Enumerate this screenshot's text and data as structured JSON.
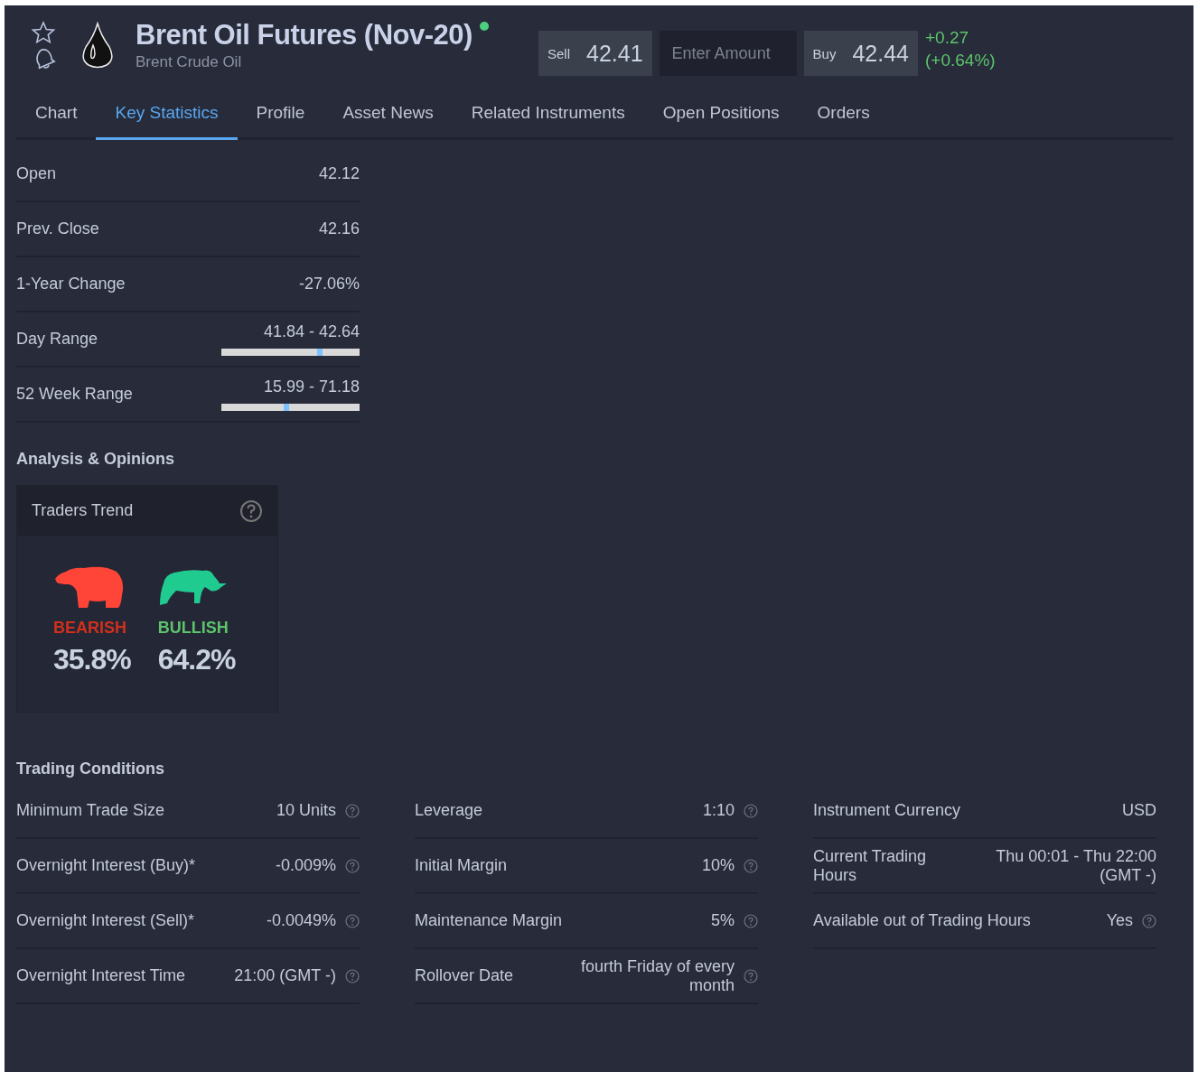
{
  "header": {
    "title": "Brent Oil Futures (Nov-20)",
    "online": true,
    "subtitle": "Brent Crude Oil",
    "sell": {
      "label": "Sell",
      "price": "42.41"
    },
    "amount": {
      "placeholder": "Enter Amount"
    },
    "buy": {
      "label": "Buy",
      "price": "42.44"
    },
    "change": "+0.27",
    "change_pct": "(+0.64%)"
  },
  "tabs": [
    {
      "label": "Chart",
      "selected": false
    },
    {
      "label": "Key Statistics",
      "selected": true
    },
    {
      "label": "Profile",
      "selected": false
    },
    {
      "label": "Asset News",
      "selected": false
    },
    {
      "label": "Related Instruments",
      "selected": false
    },
    {
      "label": "Open Positions",
      "selected": false
    },
    {
      "label": "Orders",
      "selected": false
    }
  ],
  "stats": [
    {
      "label": "Open",
      "value": "42.12"
    },
    {
      "label": "Prev. Close",
      "value": "42.16"
    },
    {
      "label": "1-Year Change",
      "value": "-27.06%"
    },
    {
      "label": "Day Range",
      "value": "41.84 - 42.64",
      "level": 0.71
    },
    {
      "label": "52 Week Range",
      "value": "15.99 - 71.18",
      "level": 0.47
    }
  ],
  "analysis": {
    "heading": "Analysis & Opinions",
    "card_title": "Traders Trend",
    "trends": [
      {
        "kind": "bear",
        "label": "BEARISH",
        "color": "#d0301c",
        "percent": "35.8%"
      },
      {
        "kind": "bull",
        "label": "BULLISH",
        "color": "#5cc46a",
        "percent": "64.2%"
      }
    ]
  },
  "trading": {
    "heading": "Trading Conditions",
    "columns": [
      [
        {
          "label": "Minimum Trade Size",
          "value": "10 Units",
          "help": true
        },
        {
          "label": "Overnight Interest (Buy)*",
          "value": "-0.009%",
          "help": true
        },
        {
          "label": "Overnight Interest (Sell)*",
          "value": "-0.0049%",
          "help": true
        },
        {
          "label": "Overnight Interest Time",
          "value": "21:00 (GMT -)",
          "help": true
        }
      ],
      [
        {
          "label": "Leverage",
          "value": "1:10",
          "help": true
        },
        {
          "label": "Initial Margin",
          "value": "10%",
          "help": true
        },
        {
          "label": "Maintenance Margin",
          "value": "5%",
          "help": true
        },
        {
          "label": "Rollover Date",
          "value": "fourth Friday of every month",
          "help": true
        }
      ],
      [
        {
          "label": "Instrument Currency",
          "value": "USD",
          "help": false
        },
        {
          "label": "Current Trading Hours",
          "value": "Thu 00:01 - Thu 22:00 (GMT -)",
          "help": false
        },
        {
          "label": "Available out of Trading Hours",
          "value": "Yes",
          "help": true
        }
      ]
    ]
  }
}
